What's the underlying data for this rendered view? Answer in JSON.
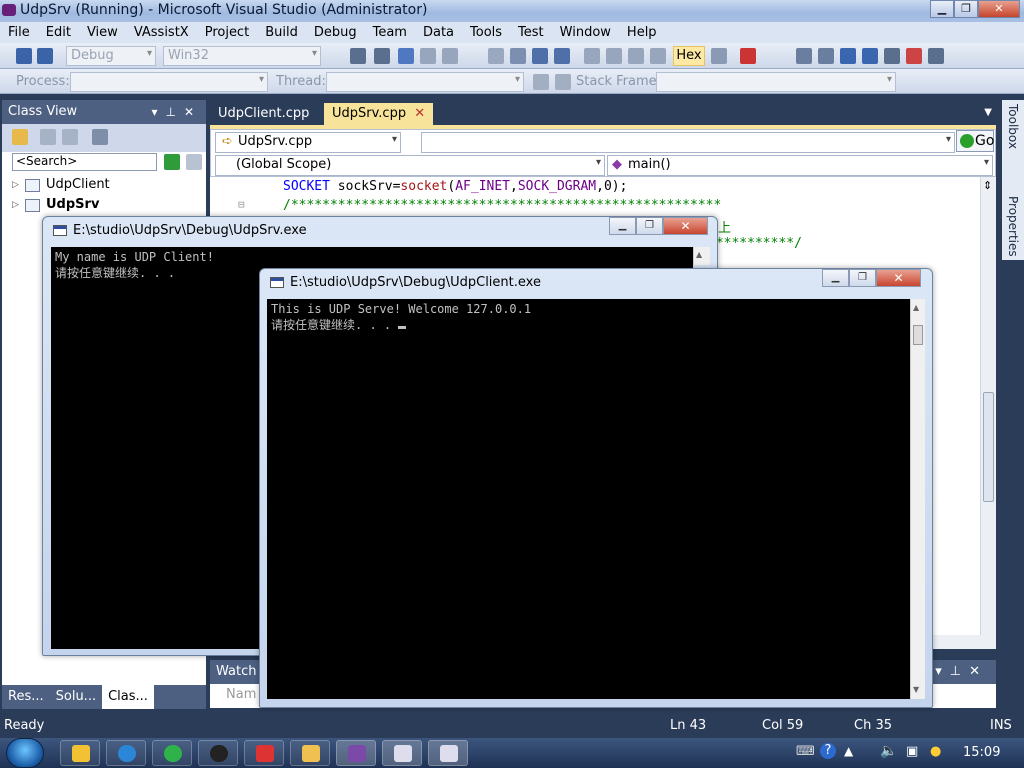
{
  "window": {
    "title": "UdpSrv (Running) - Microsoft Visual Studio (Administrator)",
    "min": "▁",
    "max": "❐",
    "close": "✕"
  },
  "menu": [
    "File",
    "Edit",
    "View",
    "VAssistX",
    "Project",
    "Build",
    "Debug",
    "Team",
    "Data",
    "Tools",
    "Test",
    "Window",
    "Help"
  ],
  "toolbar1": {
    "config": "Debug",
    "platform": "Win32",
    "hex": "Hex"
  },
  "toolbar2": {
    "process_label": "Process:",
    "thread_label": "Thread:",
    "stack_label": "Stack Frame:"
  },
  "classview": {
    "title": "Class View",
    "search_placeholder": "<Search>",
    "tree": [
      {
        "label": "UdpClient"
      },
      {
        "label": "UdpSrv"
      }
    ],
    "tabs": [
      "Res...",
      "Solu...",
      "Clas..."
    ]
  },
  "editor": {
    "tabs": [
      "UdpClient.cpp",
      "UdpSrv.cpp"
    ],
    "active_tab": "UdpSrv.cpp",
    "file_combo": "UdpSrv.cpp",
    "scope_combo": "(Global Scope)",
    "member_combo": "main()",
    "go": "Go",
    "code_lines": [
      "SOCKET sockSrv=socket(AF_INET,SOCK_DGRAM,0);",
      "/*******************************************************"
    ],
    "fragment_1": "上",
    "fragment_2": "***********/"
  },
  "rail": {
    "toolbox": "Toolbox",
    "properties": "Properties"
  },
  "watch": {
    "title": "Watch",
    "col": "Nam"
  },
  "status": {
    "ready": "Ready",
    "ln": "Ln 43",
    "col": "Col 59",
    "ch": "Ch 35",
    "mode": "INS"
  },
  "console_srv": {
    "title": "E:\\studio\\UdpSrv\\Debug\\UdpSrv.exe",
    "lines": [
      "My name is UDP Client!",
      "请按任意键继续. . ."
    ]
  },
  "console_client": {
    "title": "E:\\studio\\UdpSrv\\Debug\\UdpClient.exe",
    "lines": [
      "This is UDP Serve! Welcome 127.0.0.1",
      "请按任意键继续. . . "
    ]
  },
  "taskbar": {
    "time": "15:09"
  },
  "colors": {
    "accent_tab": "#f7e49a",
    "panel": "#4d6082",
    "vs_bg": "#2b3c59",
    "keyword": "#0000ff",
    "comment": "#008000",
    "macro": "#6f008a",
    "func": "#a31515"
  }
}
